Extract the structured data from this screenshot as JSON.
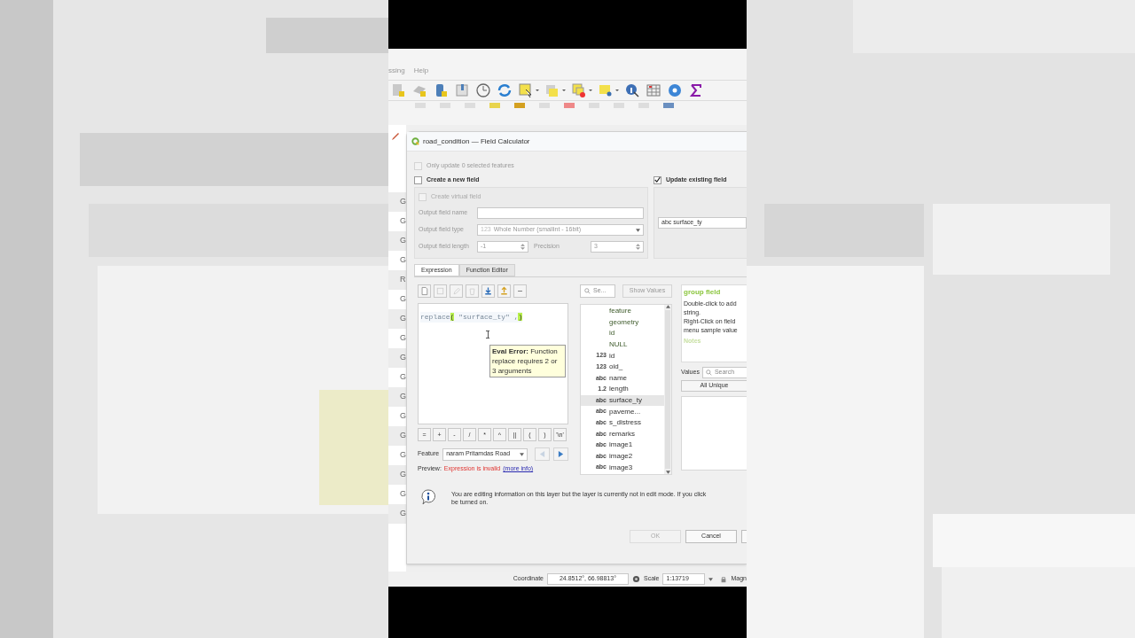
{
  "menu": [
    {
      "label": "ssing"
    },
    {
      "label": "Help"
    }
  ],
  "strip_rows": [
    "G",
    "G",
    "G",
    "G",
    "R",
    "G",
    "G",
    "G",
    "G",
    "G",
    "G",
    "G",
    "G",
    "G",
    "G",
    "G",
    "G"
  ],
  "dialog": {
    "title": "road_condition — Field Calculator",
    "only_selected": {
      "label": "Only update 0 selected features",
      "checked": false,
      "disabled": true
    },
    "create_new": {
      "label": "Create a new field",
      "checked": false
    },
    "update_existing": {
      "label": "Update existing field",
      "checked": true
    },
    "virtual": {
      "label": "Create virtual field",
      "checked": false,
      "disabled": true
    },
    "field_name": {
      "label": "Output field name"
    },
    "field_type": {
      "label": "Output field type",
      "type_tag": "123",
      "value": "Whole Number (smallint - 16bit)"
    },
    "field_length": {
      "label": "Output field length",
      "value": "-1"
    },
    "precision": {
      "label": "Precision",
      "value": "3"
    },
    "existing_field": {
      "type_tag": "abc",
      "value": "surface_ty"
    },
    "tabs": [
      {
        "label": "Expression",
        "selected": true
      },
      {
        "label": "Function Editor",
        "selected": false
      }
    ],
    "expression": [
      {
        "text": "replace",
        "highlight": false
      },
      {
        "text": "(",
        "highlight": true
      },
      {
        "text": " \"surface_ty\" ,",
        "highlight": false
      },
      {
        "text": ")",
        "highlight": true
      }
    ],
    "tooltip": "**Eval Error:** Function replace requires 2 or 3 arguments",
    "operators": [
      "=",
      "+",
      "-",
      "/",
      "*",
      "^",
      "||",
      "(",
      ")",
      "'\\n'"
    ],
    "feature": {
      "label": "Feature",
      "value": "naram Pritamdas Road"
    },
    "preview": {
      "label": "Preview:",
      "message": "Expression is invalid",
      "link": "(more info)"
    },
    "search": {
      "placeholder": "Se..."
    },
    "show_values": "Show Values",
    "functions": [
      {
        "label": "feature",
        "selected": false
      },
      {
        "label": "geometry",
        "selected": false
      },
      {
        "label": "id",
        "selected": false
      },
      {
        "label": "NULL",
        "selected": false
      },
      {
        "tag": "123",
        "label": "id",
        "selected": false
      },
      {
        "tag": "123",
        "label": "oid_",
        "selected": false
      },
      {
        "tag": "abc",
        "label": "name",
        "selected": false
      },
      {
        "tag": "1.2",
        "label": "length",
        "selected": false
      },
      {
        "tag": "abc",
        "label": "surface_ty",
        "selected": true
      },
      {
        "tag": "abc",
        "label": "paveme...",
        "selected": false
      },
      {
        "tag": "abc",
        "label": "s_distress",
        "selected": false
      },
      {
        "tag": "abc",
        "label": "remarks",
        "selected": false
      },
      {
        "tag": "abc",
        "label": "image1",
        "selected": false
      },
      {
        "tag": "abc",
        "label": "image2",
        "selected": false
      },
      {
        "tag": "abc",
        "label": "image3",
        "selected": false
      }
    ],
    "help": {
      "title": "group field",
      "lines": [
        "Double-click to add",
        "string.",
        "Right-Click on field",
        "menu sample value"
      ],
      "notes": "Notes"
    },
    "values": {
      "label": "Values",
      "placeholder": "Search",
      "button": "All Unique"
    },
    "message": [
      "You are editing information on this layer but the layer is currently not in edit mode. If you click",
      "be turned on."
    ],
    "buttons": [
      {
        "label": "OK",
        "disabled": true
      },
      {
        "label": "Cancel",
        "disabled": false
      }
    ]
  },
  "status": {
    "coordinate_label": "Coordinate",
    "coordinate": "24.8512°, 66.98813°",
    "scale_label": "Scale",
    "scale": "1:13719",
    "magnifier_label": "Magn"
  }
}
